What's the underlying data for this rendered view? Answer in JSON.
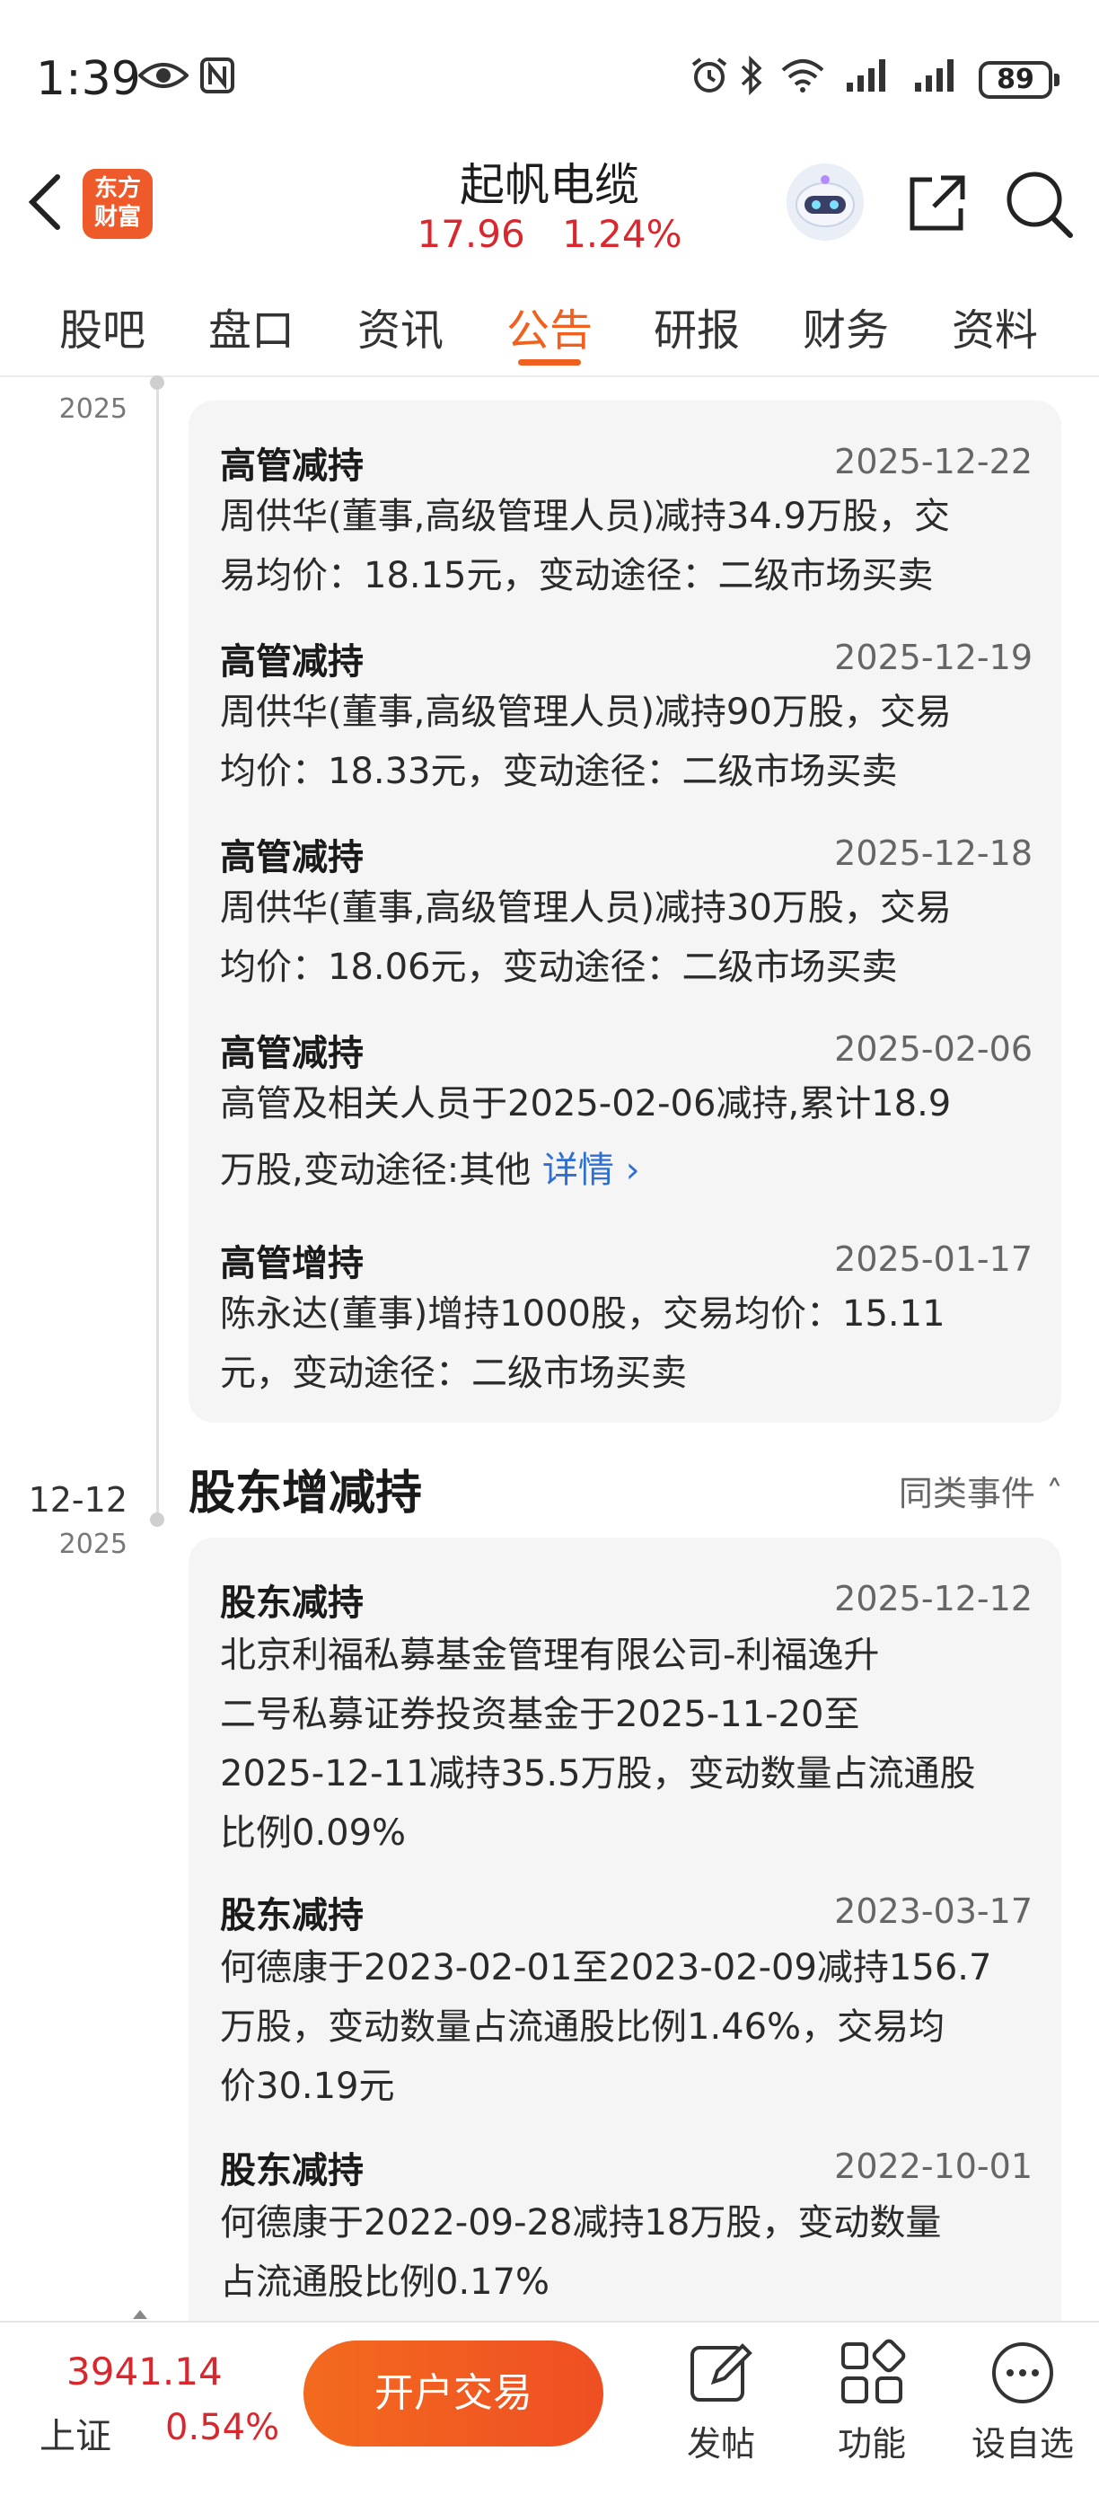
{
  "status_bar": {
    "time": "1:39",
    "battery": "89"
  },
  "header": {
    "logo_line1": "东方",
    "logo_line2": "财富",
    "stock_name": "起帆电缆",
    "price": "17.96",
    "change": "1.24%"
  },
  "tabs": [
    {
      "label": "股吧"
    },
    {
      "label": "盘口"
    },
    {
      "label": "资讯"
    },
    {
      "label": "公告",
      "active": true
    },
    {
      "label": "研报"
    },
    {
      "label": "财务"
    },
    {
      "label": "资料"
    }
  ],
  "timeline": {
    "first_year": "2025",
    "second_date": "12-12",
    "second_year": "2025"
  },
  "group1": {
    "items": [
      {
        "title": "高管减持",
        "date": "2025-12-22",
        "line1": "周供华(董事,高级管理人员)减持34.9万股，交",
        "line2": "易均价：18.15元，变动途径：二级市场买卖"
      },
      {
        "title": "高管减持",
        "date": "2025-12-19",
        "line1": "周供华(董事,高级管理人员)减持90万股，交易",
        "line2": "均价：18.33元，变动途径：二级市场买卖"
      },
      {
        "title": "高管减持",
        "date": "2025-12-18",
        "line1": "周供华(董事,高级管理人员)减持30万股，交易",
        "line2": "均价：18.06元，变动途径：二级市场买卖"
      },
      {
        "title": "高管减持",
        "date": "2025-02-06",
        "line1": "高管及相关人员于2025-02-06减持,累计18.9",
        "line2": "万股,变动途径:其他 ",
        "link": "详情 ›"
      },
      {
        "title": "高管增持",
        "date": "2025-01-17",
        "line1": "陈永达(董事)增持1000股，交易均价：15.11",
        "line2": "元，变动途径：二级市场买卖"
      }
    ]
  },
  "section2": {
    "title": "股东增减持",
    "similar": "同类事件 ˄"
  },
  "group2": {
    "items": [
      {
        "title": "股东减持",
        "date": "2025-12-12",
        "lines": [
          "北京利福私募基金管理有限公司-利福逸升",
          "二号私募证券投资基金于2025-11-20至",
          "2025-12-11减持35.5万股，变动数量占流通股",
          "比例0.09%"
        ]
      },
      {
        "title": "股东减持",
        "date": "2023-03-17",
        "lines": [
          "何德康于2023-02-01至2023-02-09减持156.7",
          "万股，变动数量占流通股比例1.46%，交易均",
          "价30.19元"
        ]
      },
      {
        "title": "股东减持",
        "date": "2022-10-01",
        "lines": [
          "何德康于2022-09-28减持18万股，变动数量",
          "占流通股比例0.17%"
        ]
      }
    ]
  },
  "bottom_bar": {
    "index_value": "3941.14",
    "index_name": "上证",
    "index_change": "0.54%",
    "trade_button": "开户交易",
    "post_label": "发帖",
    "function_label": "功能",
    "watchlist_label": "设自选"
  },
  "colors": {
    "accent": "#f0601f",
    "up": "#d9272e",
    "link": "#2f6fd1"
  }
}
